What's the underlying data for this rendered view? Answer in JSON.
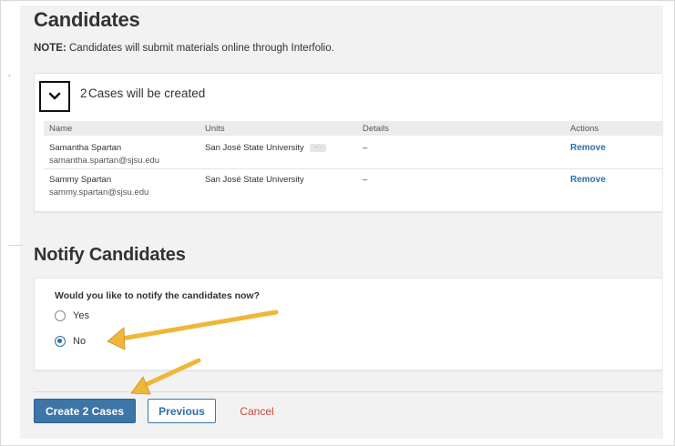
{
  "candidates": {
    "title": "Candidates",
    "note_label": "NOTE:",
    "note_text": "Candidates will submit materials online through Interfolio."
  },
  "cases": {
    "count": "2",
    "title": "Cases will be created",
    "columns": [
      "Name",
      "Units",
      "Details",
      "Actions"
    ],
    "rows": [
      {
        "name": "Samantha Spartan",
        "email": "samantha.spartan@sjsu.edu",
        "unit": "San José State University",
        "details": "–",
        "action": "Remove"
      },
      {
        "name": "Sammy Spartan",
        "email": "sammy.spartan@sjsu.edu",
        "unit": "San José State University",
        "details": "–",
        "action": "Remove"
      }
    ]
  },
  "notify": {
    "title": "Notify Candidates",
    "question": "Would you like to notify the candidates now?",
    "options": [
      "Yes",
      "No"
    ],
    "selected": "No"
  },
  "actions": {
    "create_label": "Create 2 Cases",
    "previous_label": "Previous",
    "cancel_label": "Cancel"
  },
  "colors": {
    "primary": "#3d75a7",
    "link": "#2f6fa6",
    "danger": "#c9453d",
    "annotation_arrow": "#f0b63a"
  }
}
